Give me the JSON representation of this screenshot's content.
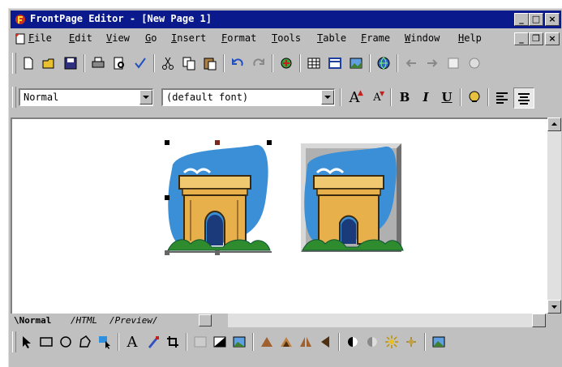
{
  "window": {
    "title": "FrontPage Editor - [New Page 1]",
    "controls": {
      "minimize": "_",
      "maximize": "□",
      "close": "×"
    },
    "doc_controls": {
      "minimize": "_",
      "restore": "❐",
      "close": "×"
    }
  },
  "menu": [
    {
      "label": "File",
      "underline": "F",
      "rest": "ile"
    },
    {
      "label": "Edit",
      "underline": "E",
      "rest": "dit"
    },
    {
      "label": "View",
      "underline": "V",
      "rest": "iew"
    },
    {
      "label": "Go",
      "underline": "G",
      "rest": "o"
    },
    {
      "label": "Insert",
      "underline": "I",
      "rest": "nsert"
    },
    {
      "label": "Format",
      "underline": "F",
      "rest": "ormat"
    },
    {
      "label": "Tools",
      "underline": "T",
      "rest": "ools"
    },
    {
      "label": "Table",
      "underline": "T",
      "rest": "able"
    },
    {
      "label": "Frame",
      "underline": "F",
      "rest": "rame"
    },
    {
      "label": "Window",
      "underline": "W",
      "rest": "indow"
    },
    {
      "label": "Help",
      "underline": "H",
      "rest": "elp"
    }
  ],
  "format_toolbar": {
    "style_value": "Normal",
    "font_value": "(default font)",
    "increase_font": "A",
    "decrease_font": "A",
    "bold": "B",
    "italic": "I",
    "underline": "U"
  },
  "view_tabs": {
    "normal": "Normal",
    "html": "HTML",
    "preview": "Preview"
  },
  "colors": {
    "titlebar": "#0a1a8c",
    "sky": "#3a8fd6",
    "arch": "#e8b04a",
    "grass": "#2e8b2e"
  },
  "icons": {
    "standard_toolbar": [
      "new-page-icon",
      "open-icon",
      "save-icon",
      "print-icon",
      "print-preview-icon",
      "spelling-icon",
      "cut-icon",
      "copy-icon",
      "paste-icon",
      "undo-icon",
      "redo-icon",
      "webbot-icon",
      "insert-table-icon",
      "insert-image-icon",
      "hyperlink-icon",
      "back-icon",
      "forward-icon",
      "refresh-icon",
      "stop-icon"
    ],
    "image_toolbar": [
      "select-icon",
      "rectangle-icon",
      "circle-icon",
      "polygon-icon",
      "highlight-hotspots-icon",
      "text-icon",
      "make-transparent-icon",
      "crop-icon",
      "washout-icon",
      "black-white-icon",
      "restore-icon",
      "rotate-left-icon",
      "rotate-right-icon",
      "flip-horizontal-icon",
      "flip-vertical-icon",
      "more-contrast-icon",
      "less-contrast-icon",
      "more-brightness-icon",
      "less-brightness-icon",
      "bevel-icon"
    ]
  }
}
